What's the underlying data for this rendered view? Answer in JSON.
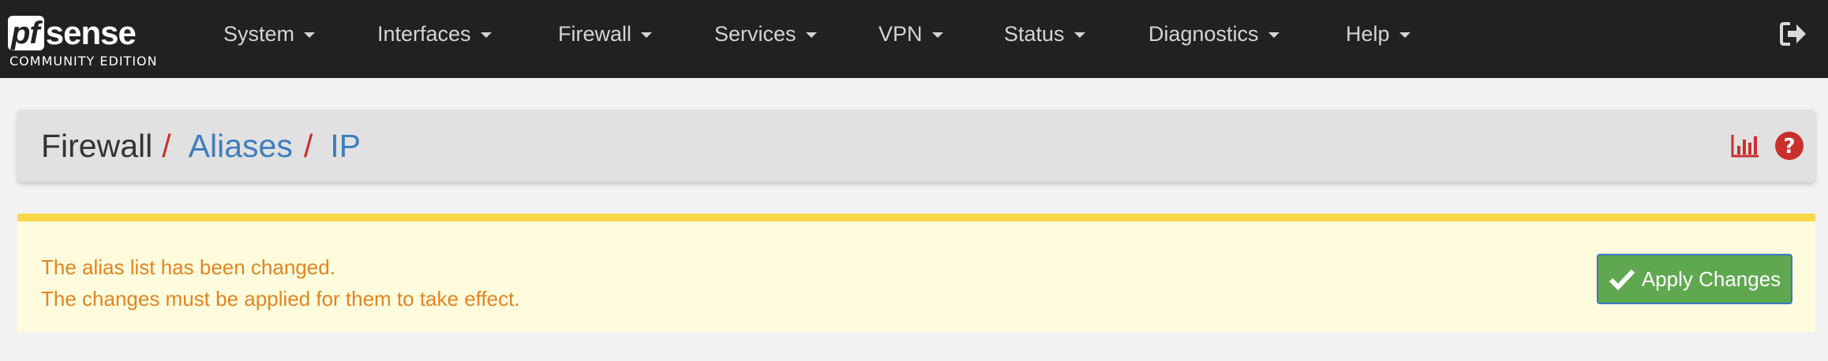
{
  "logo": {
    "pf": "pf",
    "sense": "sense",
    "edition": "COMMUNITY EDITION"
  },
  "nav": {
    "items": [
      {
        "label": "System"
      },
      {
        "label": "Interfaces"
      },
      {
        "label": "Firewall"
      },
      {
        "label": "Services"
      },
      {
        "label": "VPN"
      },
      {
        "label": "Status"
      },
      {
        "label": "Diagnostics"
      },
      {
        "label": "Help"
      }
    ],
    "logout_icon": "sign-out-icon"
  },
  "breadcrumb": {
    "root": "Firewall",
    "sep1": "/",
    "middle": "Aliases",
    "sep2": "/",
    "current": "IP",
    "icons": [
      "bar-chart-icon",
      "question-circle-icon"
    ]
  },
  "alert": {
    "line1": "The alias list has been changed.",
    "line2": "The changes must be applied for them to take effect.",
    "button_label": "Apply Changes",
    "button_icon": "check-icon"
  },
  "colors": {
    "navbar": "#212121",
    "link": "#3e7ebd",
    "separator": "#c9302c",
    "alert_text": "#e38424",
    "alert_bg": "#fefcdc",
    "alert_border": "#f7d84a",
    "button_bg": "#5fa84f"
  }
}
